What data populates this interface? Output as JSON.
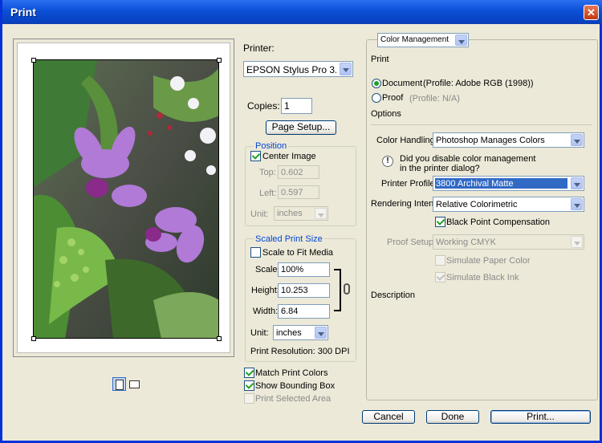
{
  "window": {
    "title": "Print"
  },
  "preview": {
    "photo_caption": "",
    "buttons": [
      {
        "name": "portrait-orientation-icon"
      },
      {
        "name": "landscape-orientation-icon"
      }
    ]
  },
  "printer": {
    "label": "Printer:",
    "value": "EPSON Stylus Pro 3..."
  },
  "copies": {
    "label": "Copies:",
    "value": "1"
  },
  "page_setup": {
    "label": "Page Setup..."
  },
  "position": {
    "title": "Position",
    "center_image": "Center Image",
    "center_image_checked": true,
    "top_label": "Top:",
    "top_value": "0.602",
    "left_label": "Left:",
    "left_value": "0.597",
    "unit_label": "Unit:",
    "unit_value": "inches"
  },
  "scaled": {
    "title": "Scaled Print Size",
    "scale_to_fit": "Scale to Fit Media",
    "scale_to_fit_checked": false,
    "scale_label": "Scale:",
    "scale_value": "100%",
    "height_label": "Height:",
    "height_value": "10.253",
    "width_label": "Width:",
    "width_value": "6.84",
    "unit_label": "Unit:",
    "unit_value": "inches",
    "resolution": "Print Resolution: 300 DPI"
  },
  "bottom_checks": {
    "match_colors": "Match Print Colors",
    "bounding_box": "Show Bounding Box",
    "selected_area": "Print Selected Area"
  },
  "right": {
    "mode_select": "Color Management",
    "print_heading": "Print",
    "document_label": "Document",
    "document_profile": "(Profile: Adobe RGB (1998))",
    "proof_label": "Proof",
    "proof_profile": "(Profile: N/A)",
    "options_heading": "Options",
    "color_handling_label": "Color Handling:",
    "color_handling_value": "Photoshop Manages Colors",
    "warning_text_1": "Did you disable color management",
    "warning_text_2": "in the printer dialog?",
    "printer_profile_label": "Printer Profile:",
    "printer_profile_value": "3800 Archival Matte",
    "rendering_label": "Rendering Intent:",
    "rendering_value": "Relative Colorimetric",
    "bpc_label": "Black Point Compensation",
    "proof_setup_label": "Proof Setup:",
    "proof_setup_value": "Working CMYK",
    "sim_paper": "Simulate Paper Color",
    "sim_ink": "Simulate Black Ink",
    "description_heading": "Description"
  },
  "buttons": {
    "cancel": "Cancel",
    "done": "Done",
    "print": "Print..."
  },
  "colors": {
    "accent": "#316ac5",
    "titlebar": "#0a4fd6",
    "group_title": "#0046d5",
    "face": "#ece9d8"
  }
}
